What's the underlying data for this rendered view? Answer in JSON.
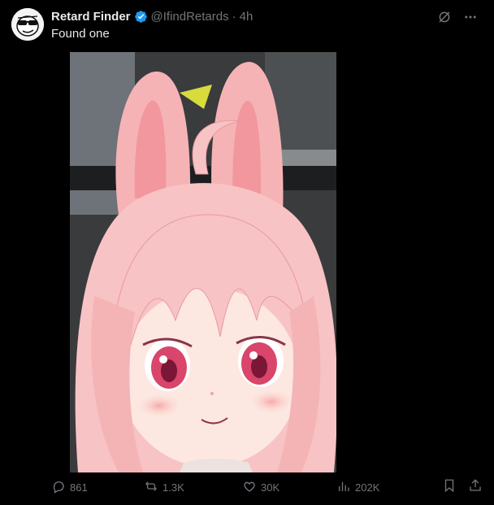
{
  "post": {
    "display_name": "Retard Finder",
    "handle": "@IfindRetards",
    "separator": "·",
    "time": "4h",
    "text": "Found one"
  },
  "actions": {
    "replies": "861",
    "reposts": "1.3K",
    "likes": "30K",
    "views": "202K"
  },
  "icons": {
    "verified": "verified-badge-icon",
    "grok": "grok-icon",
    "more": "more-icon",
    "reply": "reply-icon",
    "repost": "repost-icon",
    "like": "heart-icon",
    "views": "views-icon",
    "bookmark": "bookmark-icon",
    "share": "share-icon"
  },
  "colors": {
    "background": "#000000",
    "text": "#e7e9ea",
    "muted": "#71767b",
    "verified": "#1d9bf0"
  }
}
